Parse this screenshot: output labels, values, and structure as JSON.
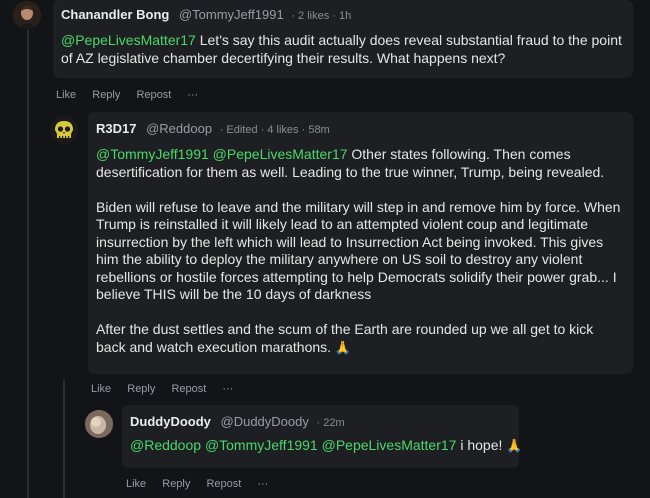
{
  "comments": [
    {
      "author": "Chanandler Bong",
      "handle": "@TommyJeff1991",
      "meta": "· 2 likes · 1h",
      "mention1": "@PepeLivesMatter17",
      "text": " Let's say this audit actually does reveal substantial fraud to the point of AZ legislative chamber decertifying their results. What happens next?",
      "actions": {
        "like": "Like",
        "reply": "Reply",
        "repost": "Repost",
        "more": "···"
      }
    },
    {
      "author": "R3D17",
      "handle": "@Reddoop",
      "meta": "· Edited · 4 likes · 58m",
      "mention1": "@TommyJeff1991",
      "mention2": "@PepeLivesMatter17",
      "p1": " Other states following. Then comes desertification for them as well. Leading to the true winner, Trump, being revealed.",
      "p2": "Biden will refuse to leave and the military will step in and remove him by force. When Trump is reinstalled it will likely lead to an attempted violent coup and legitimate insurrection by the left which will lead to Insurrection Act being invoked. This gives him the ability to deploy the military anywhere on US soil to destroy any violent rebellions or hostile forces attempting to help Democrats solidify their power grab... I believe THIS will be the 10 days of darkness",
      "p3": "After the dust settles and the scum of the Earth are rounded up we all get to kick back and watch execution marathons.",
      "emoji": "🙏",
      "actions": {
        "like": "Like",
        "reply": "Reply",
        "repost": "Repost",
        "more": "···"
      }
    },
    {
      "author": "DuddyDoody",
      "handle": "@DuddyDoody",
      "meta": "· 22m",
      "mention1": "@Reddoop",
      "mention2": "@TommyJeff1991",
      "mention3": "@PepeLivesMatter17",
      "text": " i hope!",
      "emoji": "🙏",
      "actions": {
        "like": "Like",
        "reply": "Reply",
        "repost": "Repost",
        "more": "···"
      }
    }
  ],
  "colors": {
    "background": "#131417",
    "card": "#1e1f22",
    "mention": "#4ad86a"
  },
  "icons": [
    "avatar-chanandler",
    "avatar-r3d17-skull",
    "avatar-duddydoody"
  ]
}
